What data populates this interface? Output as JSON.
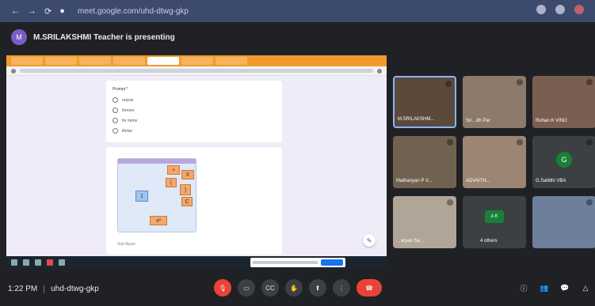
{
  "browser": {
    "url": "meet.google.com/uhd-dtwg-gkp"
  },
  "presenter": {
    "initials": "M",
    "banner": "M.SRILAKSHMI Teacher is presenting"
  },
  "shared_screen": {
    "question": "Prompt *",
    "options": [
      "repeat",
      "forever",
      "for items",
      "if/else"
    ],
    "puzzle_blocks": [
      "+",
      "(",
      ")",
      "C",
      "X",
      "1",
      "x²"
    ],
    "footer_note": "Sub-figure"
  },
  "participants": [
    {
      "name": "M.SRILAKSHM..."
    },
    {
      "name": "Sri…ith Par"
    },
    {
      "name": "Rohan K VINO"
    },
    {
      "name": "Mathanyan P V..."
    },
    {
      "name": "ADVAITH..."
    },
    {
      "name": "G.Sahithi VBA"
    },
    {
      "name": "…aryan Sa…"
    },
    {
      "name": "4 others"
    },
    {
      "name": ""
    }
  ],
  "participant_avatars": {
    "g_sahithi": "G",
    "others": "A K"
  },
  "meeting": {
    "time": "1:22 PM",
    "code": "uhd-dtwg-gkp"
  },
  "colors": {
    "end_call": "#ea4335",
    "accent": "#8ab4f8"
  }
}
